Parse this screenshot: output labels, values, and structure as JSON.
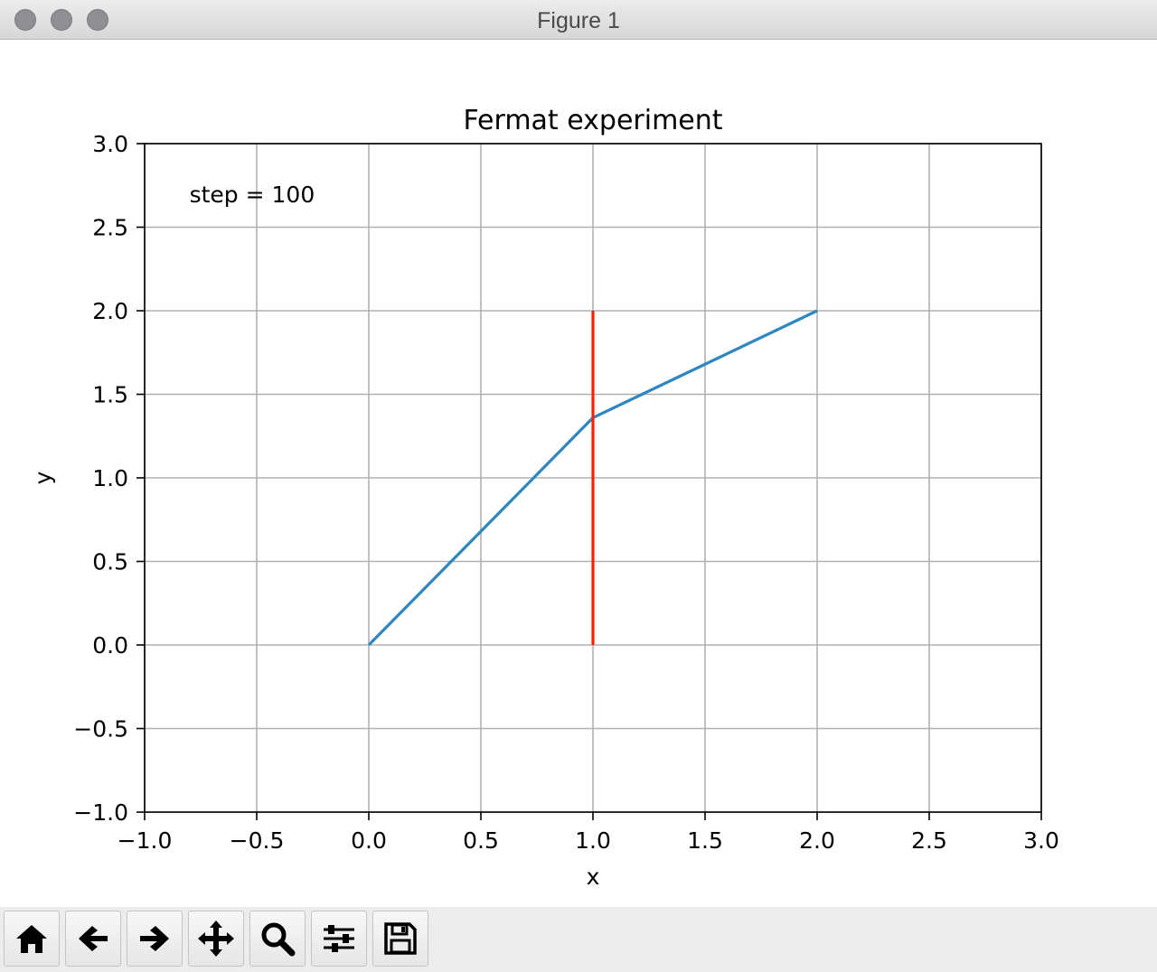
{
  "window": {
    "title": "Figure 1"
  },
  "toolbar": {
    "buttons": [
      {
        "name": "home",
        "icon": "home-icon"
      },
      {
        "name": "back",
        "icon": "arrow-left-icon"
      },
      {
        "name": "forward",
        "icon": "arrow-right-icon"
      },
      {
        "name": "pan",
        "icon": "move-arrows-icon"
      },
      {
        "name": "zoom",
        "icon": "magnifier-icon"
      },
      {
        "name": "configure-subplots",
        "icon": "sliders-icon"
      },
      {
        "name": "save",
        "icon": "floppy-disk-icon"
      }
    ]
  },
  "chart_data": {
    "type": "line",
    "title": "Fermat experiment",
    "xlabel": "x",
    "ylabel": "y",
    "xlim": [
      -1.0,
      3.0
    ],
    "ylim": [
      -1.0,
      3.0
    ],
    "xticks": [
      -1.0,
      -0.5,
      0.0,
      0.5,
      1.0,
      1.5,
      2.0,
      2.5,
      3.0
    ],
    "yticks": [
      -1.0,
      -0.5,
      0.0,
      0.5,
      1.0,
      1.5,
      2.0,
      2.5,
      3.0
    ],
    "xtick_labels": [
      "−1.0",
      "−0.5",
      "0.0",
      "0.5",
      "1.0",
      "1.5",
      "2.0",
      "2.5",
      "3.0"
    ],
    "ytick_labels": [
      "−1.0",
      "−0.5",
      "0.0",
      "0.5",
      "1.0",
      "1.5",
      "2.0",
      "2.5",
      "3.0"
    ],
    "grid": true,
    "series": [
      {
        "color": "#2e86c1",
        "x": [
          0.0,
          1.0,
          2.0
        ],
        "y": [
          0.0,
          1.36,
          2.0
        ]
      },
      {
        "color": "#ff2200",
        "x": [
          1.0,
          1.0
        ],
        "y": [
          0.0,
          2.0
        ]
      }
    ],
    "annotations": [
      {
        "text": "step = 100",
        "x": -0.8,
        "y": 2.65
      }
    ]
  }
}
